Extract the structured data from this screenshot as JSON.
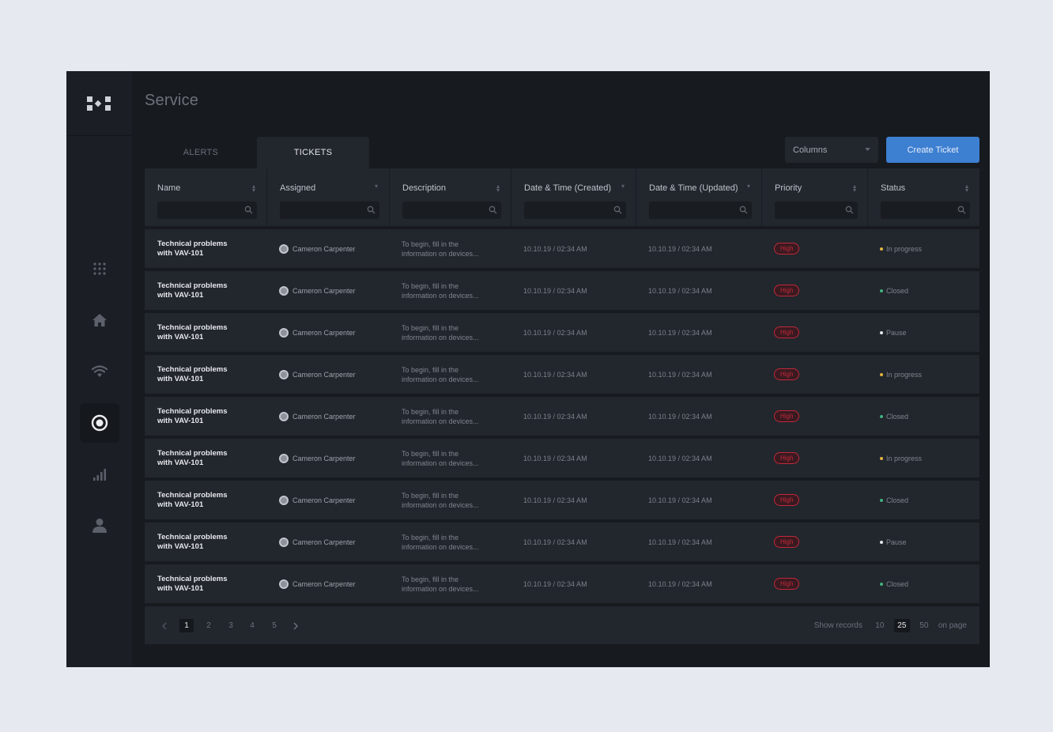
{
  "page": {
    "title": "Service"
  },
  "tabs": [
    {
      "label": "ALERTS"
    },
    {
      "label": "TICKETS"
    }
  ],
  "toolbar": {
    "columns_label": "Columns",
    "create_label": "Create Ticket"
  },
  "columns": [
    {
      "label": "Name"
    },
    {
      "label": "Assigned"
    },
    {
      "label": "Description"
    },
    {
      "label": "Date & Time (Created)"
    },
    {
      "label": "Date & Time (Updated)"
    },
    {
      "label": "Priority"
    },
    {
      "label": "Status"
    }
  ],
  "rows": [
    {
      "name1": "Technical problems",
      "name2": "with VAV-101",
      "assigned": "Cameron Carpenter",
      "desc1": "To begin, fill in the",
      "desc2": "information on devices...",
      "created": "10.10.19 / 02:34 AM",
      "updated": "10.10.19 / 02:34 AM",
      "priority": "High",
      "status": "In progress",
      "status_color": "#e3b341"
    },
    {
      "name1": "Technical problems",
      "name2": "with VAV-101",
      "assigned": "Cameron Carpenter",
      "desc1": "To begin, fill in the",
      "desc2": "information on devices...",
      "created": "10.10.19 / 02:34 AM",
      "updated": "10.10.19 / 02:34 AM",
      "priority": "High",
      "status": "Closed",
      "status_color": "#3fb27f"
    },
    {
      "name1": "Technical problems",
      "name2": "with VAV-101",
      "assigned": "Cameron Carpenter",
      "desc1": "To begin, fill in the",
      "desc2": "information on devices...",
      "created": "10.10.19 / 02:34 AM",
      "updated": "10.10.19 / 02:34 AM",
      "priority": "High",
      "status": "Pause",
      "status_color": "#e5e7eb"
    },
    {
      "name1": "Technical problems",
      "name2": "with VAV-101",
      "assigned": "Cameron Carpenter",
      "desc1": "To begin, fill in the",
      "desc2": "information on devices...",
      "created": "10.10.19 / 02:34 AM",
      "updated": "10.10.19 / 02:34 AM",
      "priority": "High",
      "status": "In progress",
      "status_color": "#e3b341"
    },
    {
      "name1": "Technical problems",
      "name2": "with VAV-101",
      "assigned": "Cameron Carpenter",
      "desc1": "To begin, fill in the",
      "desc2": "information on devices...",
      "created": "10.10.19 / 02:34 AM",
      "updated": "10.10.19 / 02:34 AM",
      "priority": "High",
      "status": "Closed",
      "status_color": "#3fb27f"
    },
    {
      "name1": "Technical problems",
      "name2": "with VAV-101",
      "assigned": "Cameron Carpenter",
      "desc1": "To begin, fill in the",
      "desc2": "information on devices...",
      "created": "10.10.19 / 02:34 AM",
      "updated": "10.10.19 / 02:34 AM",
      "priority": "High",
      "status": "In progress",
      "status_color": "#e3b341"
    },
    {
      "name1": "Technical problems",
      "name2": "with VAV-101",
      "assigned": "Cameron Carpenter",
      "desc1": "To begin, fill in the",
      "desc2": "information on devices...",
      "created": "10.10.19 / 02:34 AM",
      "updated": "10.10.19 / 02:34 AM",
      "priority": "High",
      "status": "Closed",
      "status_color": "#3fb27f"
    },
    {
      "name1": "Technical problems",
      "name2": "with VAV-101",
      "assigned": "Cameron Carpenter",
      "desc1": "To begin, fill in the",
      "desc2": "information on devices...",
      "created": "10.10.19 / 02:34 AM",
      "updated": "10.10.19 / 02:34 AM",
      "priority": "High",
      "status": "Pause",
      "status_color": "#e5e7eb"
    },
    {
      "name1": "Technical problems",
      "name2": "with VAV-101",
      "assigned": "Cameron Carpenter",
      "desc1": "To begin, fill in the",
      "desc2": "information on devices...",
      "created": "10.10.19 / 02:34 AM",
      "updated": "10.10.19 / 02:34 AM",
      "priority": "High",
      "status": "Closed",
      "status_color": "#3fb27f"
    }
  ],
  "pagination": {
    "prev_icon": "chevron-left-icon",
    "next_icon": "chevron-right-icon",
    "pages": [
      "1",
      "2",
      "3",
      "4",
      "5"
    ],
    "current_page": "1",
    "show_records_label": "Show records",
    "record_options": [
      "10",
      "25",
      "50"
    ],
    "current_records": "25",
    "on_page_label": "on page"
  },
  "sidebar": {
    "icons": [
      "apps-grid-icon",
      "home-icon",
      "wifi-icon",
      "target-icon",
      "bar-chart-icon",
      "user-icon"
    ],
    "active": "target-icon"
  },
  "colors": {
    "accent": "#3d7fd1",
    "priority_high": "#c0283a"
  }
}
